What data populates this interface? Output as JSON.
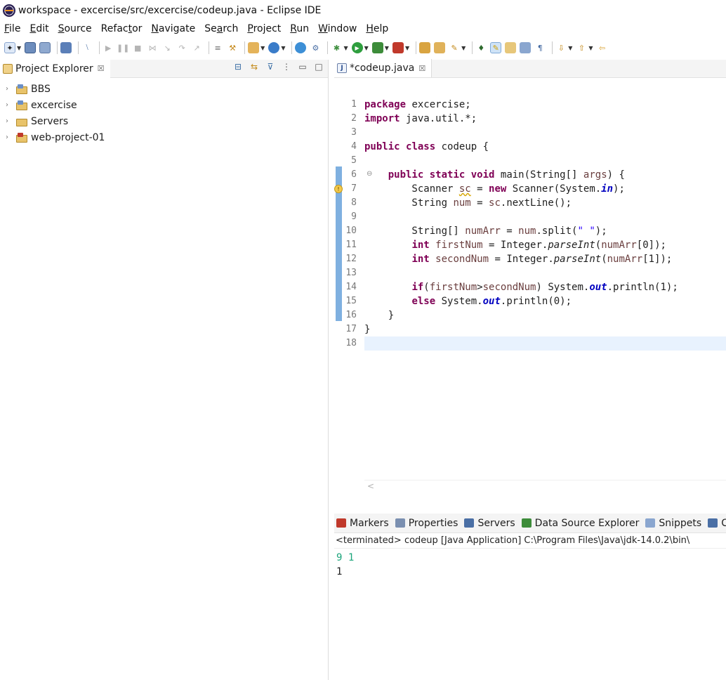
{
  "window": {
    "title": "workspace - excercise/src/excercise/codeup.java - Eclipse IDE"
  },
  "menu": [
    {
      "label_rest": "ile",
      "mnemonic": "F"
    },
    {
      "label_rest": "dit",
      "mnemonic": "E"
    },
    {
      "label_rest": "ource",
      "mnemonic": "S"
    },
    {
      "label_rest": "Refac",
      "mnemonic": "t",
      "label_tail": "or"
    },
    {
      "label_rest": "",
      "mnemonic": "N",
      "label_tail": "avigate"
    },
    {
      "label_rest": "Se",
      "mnemonic": "a",
      "label_tail": "rch"
    },
    {
      "label_rest": "",
      "mnemonic": "P",
      "label_tail": "roject"
    },
    {
      "label_rest": "",
      "mnemonic": "R",
      "label_tail": "un"
    },
    {
      "label_rest": "",
      "mnemonic": "W",
      "label_tail": "indow"
    },
    {
      "label_rest": "",
      "mnemonic": "H",
      "label_tail": "elp"
    }
  ],
  "explorer": {
    "title": "Project Explorer",
    "close_glyph": "☒",
    "projects": [
      {
        "name": "BBS",
        "type": "java"
      },
      {
        "name": "excercise",
        "type": "java"
      },
      {
        "name": "Servers",
        "type": "folder"
      },
      {
        "name": "web-project-01",
        "type": "web"
      }
    ]
  },
  "editor": {
    "tab_label": "*codeup.java",
    "close_glyph": "☒",
    "line_numbers": [
      "1",
      "2",
      "3",
      "4",
      "5",
      "6",
      "7",
      "8",
      "9",
      "10",
      "11",
      "12",
      "13",
      "14",
      "15",
      "16",
      "17",
      "18"
    ],
    "current_line": 18
  },
  "bottom": {
    "tabs": [
      "Markers",
      "Properties",
      "Servers",
      "Data Source Explorer",
      "Snippets",
      "Co"
    ],
    "console_description": "<terminated> codeup [Java Application] C:\\Program Files\\Java\\jdk-14.0.2\\bin\\",
    "output_input": "9 1",
    "output_result": "1"
  },
  "colors": {
    "keyword": "#7f0055",
    "string": "#2a00ff",
    "static_field": "#0000c0",
    "console_input": "#1aa47a",
    "current_line": "#e8f2fe"
  }
}
